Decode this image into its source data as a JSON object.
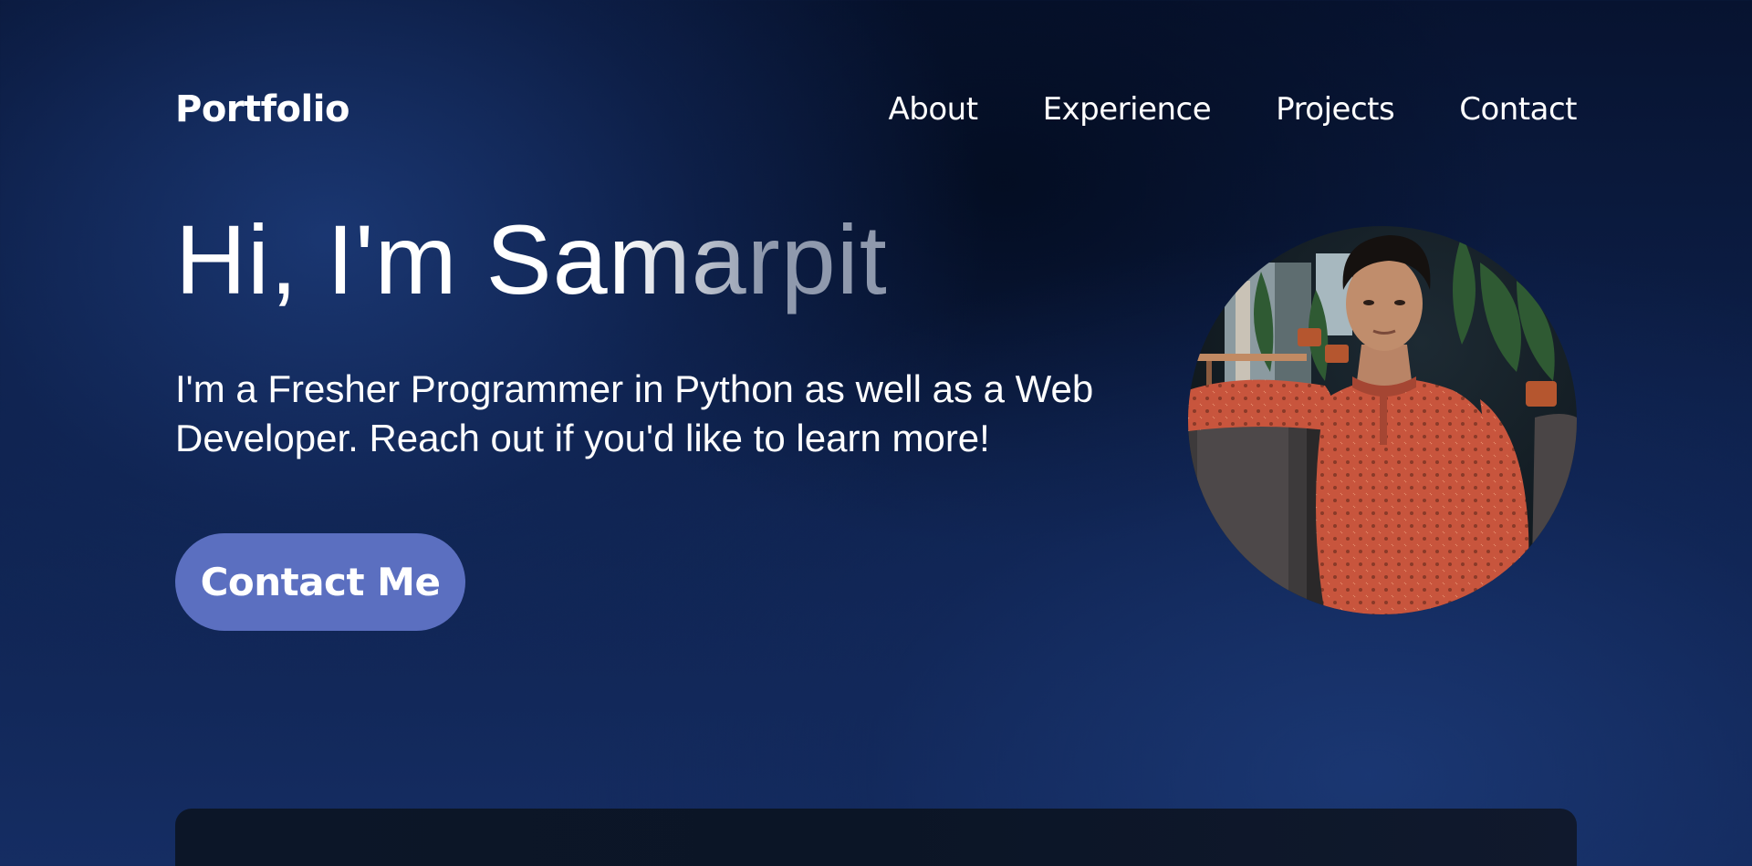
{
  "nav": {
    "logo": "Portfolio",
    "links": [
      {
        "label": "About"
      },
      {
        "label": "Experience"
      },
      {
        "label": "Projects"
      },
      {
        "label": "Contact"
      }
    ]
  },
  "hero": {
    "title": "Hi, I'm Samarpit",
    "description": "I'm a Fresher Programmer in Python as well as a Web Developer. Reach out if you'd like to learn more!",
    "cta_label": "Contact Me"
  },
  "colors": {
    "background": "#0a1633",
    "accent_button": "#5b6fc0",
    "text": "#ffffff"
  }
}
